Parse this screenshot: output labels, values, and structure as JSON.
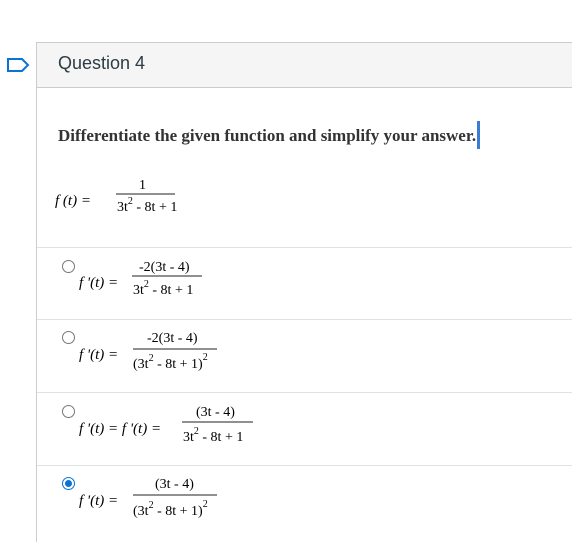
{
  "question": {
    "title": "Question 4",
    "prompt": "Differentiate the given function and simplify your answer.",
    "given": {
      "lhs": "f (t) =",
      "numerator": "1",
      "den_a": "3t",
      "den_a_exp": "2",
      "den_b": " - 8t + 1"
    }
  },
  "options": [
    {
      "lhs": "f '(t) =",
      "numerator": "-2(3t - 4)",
      "den_open": "",
      "den_a": "3t",
      "den_a_exp": "2",
      "den_b": " - 8t + 1",
      "den_close": "",
      "den_outer_exp": "",
      "selected": false
    },
    {
      "lhs": "f '(t) =",
      "numerator": "-2(3t - 4)",
      "den_open": "(",
      "den_a": "3t",
      "den_a_exp": "2",
      "den_b": " - 8t + 1",
      "den_close": ")",
      "den_outer_exp": "2",
      "selected": false
    },
    {
      "lhs": "f '(t) = f '(t) =",
      "numerator": "(3t - 4)",
      "den_open": "",
      "den_a": "3t",
      "den_a_exp": "2",
      "den_b": " - 8t + 1",
      "den_close": "",
      "den_outer_exp": "",
      "selected": false
    },
    {
      "lhs": "f '(t) =",
      "numerator": "(3t - 4)",
      "den_open": "(",
      "den_a": "3t",
      "den_a_exp": "2",
      "den_b": " - 8t + 1",
      "den_close": ")",
      "den_outer_exp": "2",
      "selected": true
    }
  ],
  "colors": {
    "flag": "#0a73d8",
    "selected": "#0a73d8",
    "cursor": "#3a7bd5"
  },
  "icons": {
    "flag": "bookmark-flag-icon"
  }
}
